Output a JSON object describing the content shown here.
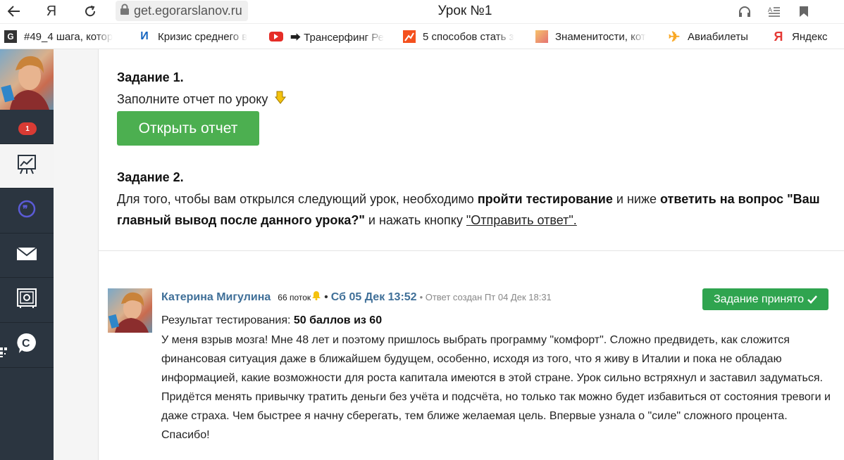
{
  "browser": {
    "url": "get.egorarslanov.ru",
    "tab_title": "Урок №1"
  },
  "bookmarks": [
    {
      "label": "#49_4 шага, котор",
      "icon": "g-icon",
      "color": "#333333"
    },
    {
      "label": "Кризис среднего в",
      "icon": "i-icon",
      "color": "#1565c0"
    },
    {
      "label": "⮕ Трансерфинг Ре",
      "icon": "youtube-icon",
      "color": "#e52d27"
    },
    {
      "label": "5 способов стать з",
      "icon": "chart-icon",
      "color": "#f4511e"
    },
    {
      "label": "Знаменитости, кот",
      "icon": "photo-icon",
      "color": "#e57373"
    },
    {
      "label": "Авиабилеты",
      "icon": "plane-icon",
      "color": "#f9a825"
    },
    {
      "label": "Яндекс",
      "icon": "yandex-icon",
      "color": "#e53935"
    }
  ],
  "sidebar": {
    "notification_count": "1"
  },
  "task1": {
    "title": "Задание 1.",
    "text": "Заполните отчет по уроку",
    "button": "Открыть отчет"
  },
  "task2": {
    "title": "Задание 2.",
    "text_1": "Для того, чтобы вам открылся следующий урок, необходимо ",
    "bold_1": "пройти тестирование",
    "text_2": " и ниже ",
    "bold_2": "ответить на вопрос \"Ваш главный вывод после данного урока?\"",
    "text_3": " и нажать кнопку ",
    "link": "\"Отправить ответ\"."
  },
  "comment": {
    "author": "Катерина Мигулина",
    "stream": "66 поток",
    "separator": "•",
    "date": "Сб 05 Дек 13:52",
    "created": "• Ответ создан Пт 04 Дек 18:31",
    "status_button": "Задание принято",
    "result_label": "Результат тестирования: ",
    "result_value": "50 баллов из 60",
    "body": "У меня взрыв мозга! Мне 48 лет и поэтому пришлось выбрать программу \"комфорт\". Сложно предвидеть, как сложится финансовая ситуация даже в ближайшем будущем, особенно, исходя из того, что я живу в Италии и пока не обладаю информацией, какие возможности для роста капитала имеются в этой стране. Урок сильно встряхнул и заставил задуматься. Придётся менять привычку тратить деньги без учёта и подсчёта, но только так можно будет избавиться от состояния тревоги и даже страха. Чем быстрее я начну сберегать, тем ближе желаемая цель. Впервые узнала о \"силе\" сложного процента. Спасибо!"
  },
  "colors": {
    "accent_green": "#4caf50",
    "accepted_green": "#2fa44f",
    "link_blue": "#3f6f98",
    "sidebar_bg": "#2b3540"
  }
}
